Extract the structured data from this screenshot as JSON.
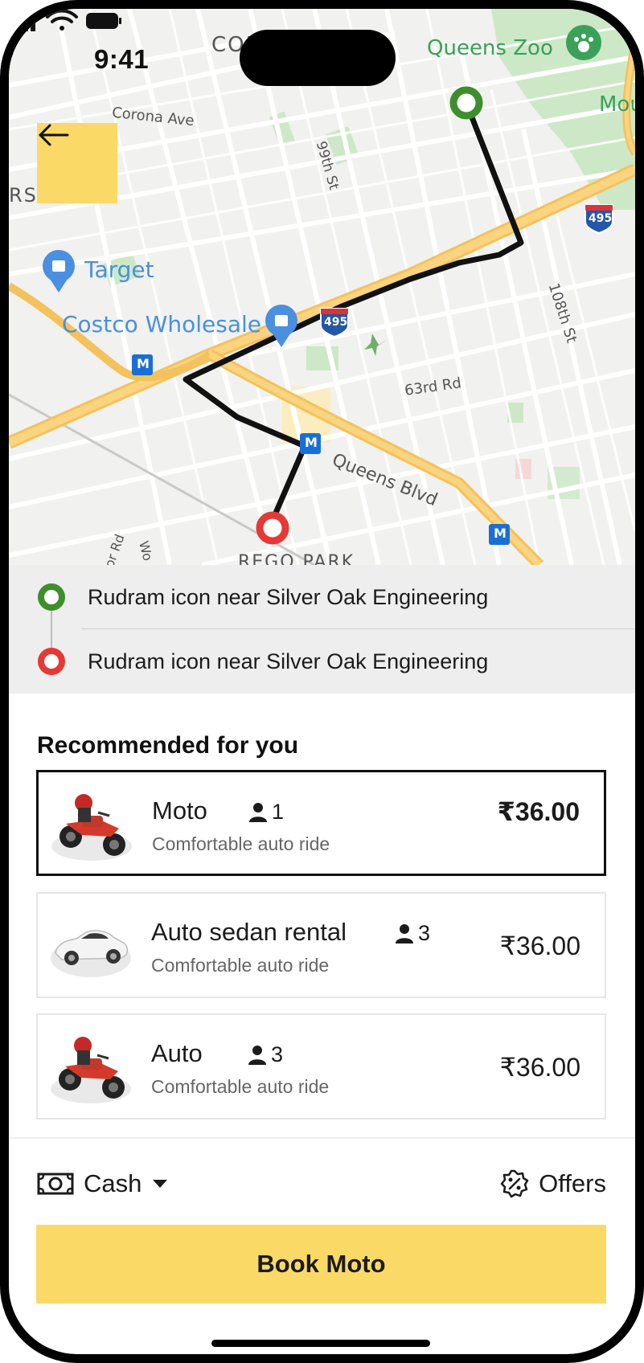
{
  "status_bar": {
    "time": "9:41"
  },
  "map": {
    "labels": {
      "corona": "CORONA",
      "queens_zoo": "Queens Zoo",
      "mou": "Mou",
      "corona_ave": "Corona Ave",
      "st_99": "99th St",
      "rs": "RS",
      "target": "Target",
      "costco": "Costco Wholesale",
      "i495_a": "495",
      "i495_b": "495",
      "st_108": "108th St",
      "rd_63": "63rd Rd",
      "queens_blvd": "Queens Blvd",
      "rego_park": "REGO PARK",
      "metro": "M",
      "or_rd": "or Rd",
      "wo": "Wo"
    },
    "route_color": "#111111",
    "pickup_color": "#3e8e2c",
    "drop_color": "#e53935"
  },
  "back_button": {
    "icon": "arrow-left-icon"
  },
  "addresses": {
    "pickup": "Rudram icon near Silver Oak Engineering",
    "drop": "Rudram icon near Silver Oak Engineering"
  },
  "section_title": "Recommended for you",
  "rides": [
    {
      "name": "Moto",
      "capacity": "1",
      "subtitle": "Comfortable auto ride",
      "price": "₹36.00",
      "icon": "motorcycle-icon",
      "selected": true
    },
    {
      "name": "Auto sedan rental",
      "capacity": "3",
      "subtitle": "Comfortable auto ride",
      "price": "₹36.00",
      "icon": "car-icon",
      "selected": false
    },
    {
      "name": "Auto",
      "capacity": "3",
      "subtitle": "Comfortable auto ride",
      "price": "₹36.00",
      "icon": "motorcycle-icon",
      "selected": false
    }
  ],
  "payment": {
    "label": "Cash",
    "icon": "cash-icon"
  },
  "offers": {
    "label": "Offers",
    "icon": "discount-badge-icon"
  },
  "book_button": {
    "label": "Book Moto"
  },
  "colors": {
    "accent": "#fbd966",
    "selected_border": "#111111"
  }
}
